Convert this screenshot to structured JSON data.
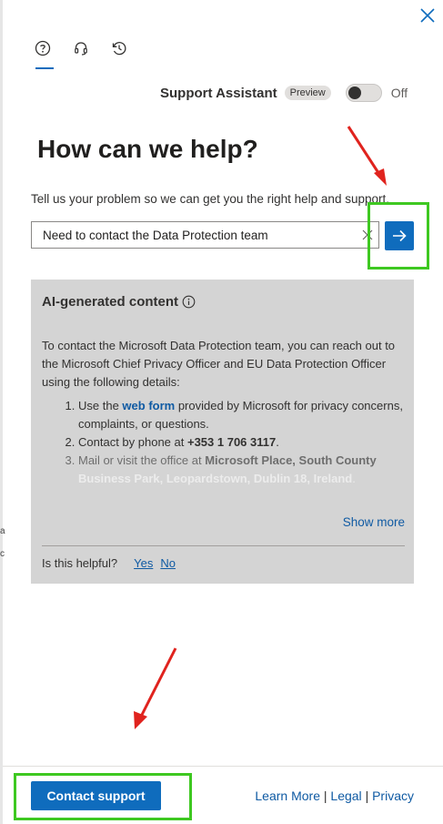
{
  "header": {
    "close_icon": "close-icon",
    "tabs": [
      {
        "icon": "help-circle-icon",
        "active": true
      },
      {
        "icon": "headset-icon",
        "active": false
      },
      {
        "icon": "history-icon",
        "active": false
      }
    ]
  },
  "assistant": {
    "label": "Support Assistant",
    "badge": "Preview",
    "toggle_state": "Off",
    "enabled": false
  },
  "main": {
    "heading": "How can we help?",
    "instructions": "Tell us your problem so we can get you the right help and support.",
    "search_value": "Need to contact the Data Protection team"
  },
  "ai_panel": {
    "title": "AI-generated content",
    "intro": "To contact the Microsoft Data Protection team, you can reach out to the Microsoft Chief Privacy Officer and EU Data Protection Officer using the following details:",
    "item1_prefix": "Use the ",
    "item1_link": "web form",
    "item1_suffix": " provided by Microsoft for privacy concerns, complaints, or questions.",
    "item2_prefix": "Contact by phone at ",
    "item2_bold": "+353 1 706 3117",
    "item2_suffix": ".",
    "item3_prefix": "Mail or visit the office at ",
    "item3_bold_visible": "Microsoft Place, South County",
    "item3_bold_faded": "Business Park, Leopardstown, Dublin 18, Ireland",
    "item3_suffix": ".",
    "show_more": "Show more",
    "helpful_question": "Is this helpful?",
    "yes": "Yes",
    "no": "No"
  },
  "footer": {
    "contact_button": "Contact support",
    "learn_more": "Learn More",
    "separator": "|",
    "legal": "Legal",
    "privacy": "Privacy"
  },
  "colors": {
    "accent": "#0f6cbd",
    "annotation_arrow": "#e0231e",
    "annotation_highlight": "#3ec821",
    "panel_bg": "#d4d4d4"
  }
}
